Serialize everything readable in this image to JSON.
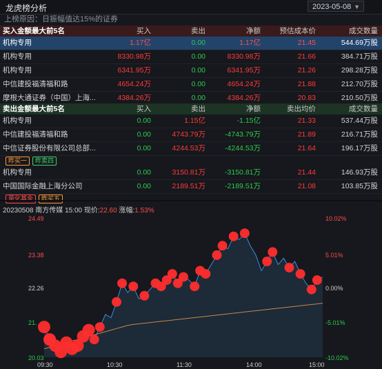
{
  "window": {
    "title": "龙虎榜分析",
    "date": "2023-05-08"
  },
  "reason": "上榜原因：日振幅值达15%的证券",
  "buy_section": {
    "headers": [
      "买入金额最大前5名",
      "买入",
      "卖出",
      "净额",
      "预估成本价",
      "成交数量"
    ],
    "rows": [
      {
        "name": "机构专用",
        "buy": "1.17亿",
        "sell": "0.00",
        "net": "1.17亿",
        "price": "21.45",
        "qty": "544.69万股"
      },
      {
        "name": "机构专用",
        "buy": "8330.98万",
        "sell": "0.00",
        "net": "8330.98万",
        "price": "21.66",
        "qty": "384.71万股"
      },
      {
        "name": "机构专用",
        "buy": "6341.95万",
        "sell": "0.00",
        "net": "6341.95万",
        "price": "21.26",
        "qty": "298.28万股"
      },
      {
        "name": "中信建投福清福和路",
        "buy": "4654.24万",
        "sell": "0.00",
        "net": "4654.24万",
        "price": "21.88",
        "qty": "212.70万股"
      },
      {
        "name": "摩根大通证券（中国）上海...",
        "buy": "4384.26万",
        "sell": "0.00",
        "net": "4384.26万",
        "price": "20.83",
        "qty": "210.50万股"
      }
    ]
  },
  "sell_section": {
    "headers": [
      "卖出金额最大前5名",
      "买入",
      "卖出",
      "净额",
      "卖出均价",
      "成交数量"
    ],
    "rows": [
      {
        "name": "机构专用",
        "buy": "0.00",
        "sell": "1.15亿",
        "net": "-1.15亿",
        "price": "21.33",
        "qty": "537.44万股"
      },
      {
        "name": "中信建投福清福和路",
        "buy": "0.00",
        "sell": "4743.79万",
        "net": "-4743.79万",
        "price": "21.89",
        "qty": "216.71万股"
      },
      {
        "name": "中信证券股份有限公司总部...",
        "buy": "0.00",
        "sell": "4244.53万",
        "net": "-4244.53万",
        "price": "21.64",
        "qty": "196.17万股"
      },
      {
        "name": "机构专用",
        "buy": "0.00",
        "sell": "3150.81万",
        "net": "-3150.81万",
        "price": "21.44",
        "qty": "146.93万股"
      },
      {
        "name": "中国国际金融上海分公司",
        "buy": "0.00",
        "sell": "2189.51万",
        "net": "-2189.51万",
        "price": "21.08",
        "qty": "103.85万股"
      }
    ],
    "tags_after_row3": [
      "昨买一",
      "昨卖四"
    ],
    "tags_after_row5": [
      "量化基金",
      "昨买五"
    ]
  },
  "chart_info": {
    "date": "20230508",
    "stock": "南方传媒",
    "time": "15:00",
    "price_label": "现价:",
    "price": "22.60",
    "change_label": "涨幅:",
    "change": "1.53%"
  },
  "chart_data": {
    "type": "line",
    "x_ticks": [
      "09:30",
      "10:30",
      "11:30",
      "14:00",
      "15:00"
    ],
    "y_left_ticks": [
      "24.49",
      "23.38",
      "22.26",
      "21.",
      "20.03"
    ],
    "y_right_ticks": [
      "10.02%",
      "5.01%",
      "0.00%",
      "-5.01%",
      "-10.02%"
    ],
    "ylim": [
      20.03,
      24.49
    ],
    "series": [
      {
        "values": [
          21.0,
          20.6,
          20.4,
          20.2,
          20.5,
          20.3,
          20.4,
          20.7,
          20.9,
          20.6,
          21.0,
          21.4,
          21.3,
          21.8,
          22.4,
          22.1,
          22.3,
          21.9,
          22.0,
          22.2,
          22.4,
          22.3,
          22.5,
          22.7,
          22.4,
          22.6,
          22.5,
          22.3,
          22.8,
          22.7,
          23.0,
          23.3,
          23.6,
          23.5,
          23.9,
          23.8,
          24.0,
          23.6,
          23.3,
          22.8,
          23.1,
          23.4,
          23.0,
          23.2,
          22.9,
          23.1,
          22.7,
          22.4,
          22.2,
          22.5,
          22.6
        ]
      },
      {
        "values": [
          20.3,
          20.35,
          20.4,
          20.45,
          20.5,
          20.55,
          20.6,
          20.65,
          20.7,
          20.75,
          20.8,
          20.85,
          20.9,
          20.95,
          21.0,
          21.05,
          21.08,
          21.1,
          21.12,
          21.14,
          21.16,
          21.18,
          21.2,
          21.22,
          21.24,
          21.26,
          21.28,
          21.3,
          21.32,
          21.34,
          21.36,
          21.38,
          21.4,
          21.42,
          21.44,
          21.46,
          21.48,
          21.5,
          21.52,
          21.54,
          21.56,
          21.58,
          21.6,
          21.62,
          21.64,
          21.66,
          21.68,
          21.7,
          21.72,
          21.74,
          21.76
        ]
      }
    ],
    "grid": false
  },
  "colors": {
    "up": "#ff3b3b",
    "down": "#2ecb4f",
    "price_line": "#3b8fe0",
    "avg_line": "#c7894a",
    "marker": "#ff2d2d"
  }
}
